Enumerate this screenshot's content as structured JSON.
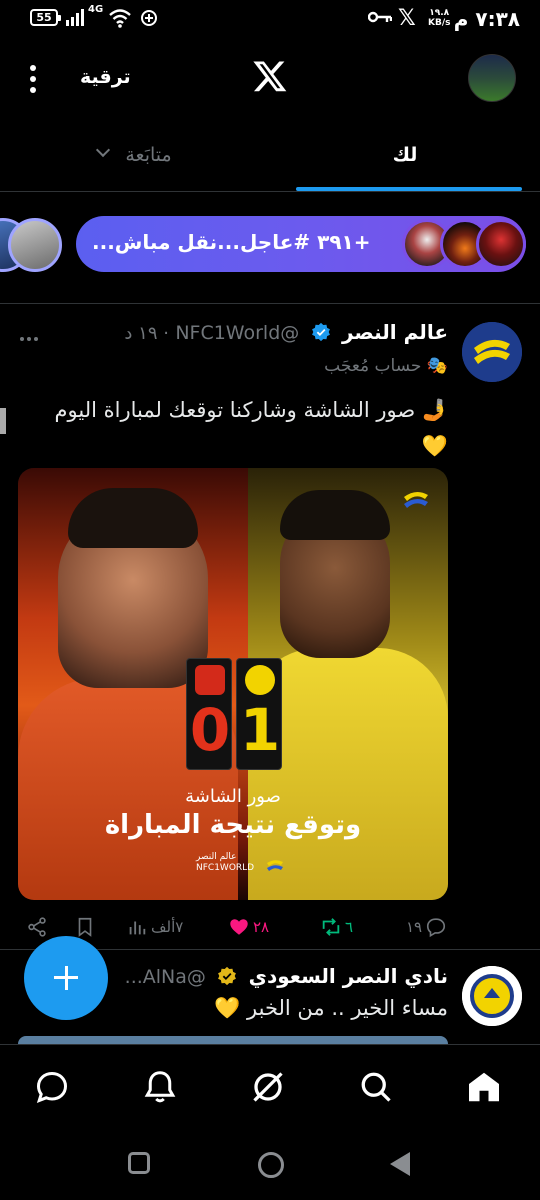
{
  "status_bar": {
    "battery": "55",
    "network": "4G",
    "time": "٧:٣٨ م",
    "speed_value": "١٩.٨",
    "speed_unit": "KB/s"
  },
  "header": {
    "upgrade_label": "ترقية"
  },
  "tabs": {
    "for_you": "لك",
    "following": "متابَعة"
  },
  "live": {
    "text": "+٣٩١ #عاجل...نقل مباش..."
  },
  "tweet1": {
    "name": "عالم النصر",
    "handle": "@NFC1World",
    "time": "١٩ د",
    "liked_by": "حساب مُعجَب",
    "text": "🤳 صور الشاشة وشاركنا توقعك لمباراة اليوم 💛",
    "media": {
      "score_left": "0",
      "score_right": "1",
      "caption_small": "صور الشاشة",
      "caption_big": "وتوقع نتيجة المباراة",
      "brand_ar": "عالم النصر",
      "brand_en": "NFC1WORLD"
    },
    "replies": "١٩",
    "retweets": "٦",
    "likes": "٢٨",
    "views": "٧ألف"
  },
  "tweet2": {
    "name": "نادي النصر السعودي",
    "handle": "@AlNa...",
    "text": "مساء الخير .. من الخبر 💛"
  },
  "colors": {
    "accent": "#1d9bf0",
    "live_pill": "#6b5bee",
    "like": "#f91880",
    "retweet": "#00ba7c"
  },
  "icons": {
    "bottom_nav": [
      "home-icon",
      "search-icon",
      "grok-icon",
      "notifications-icon",
      "messages-icon"
    ]
  }
}
